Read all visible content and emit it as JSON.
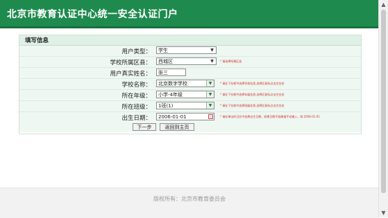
{
  "header": {
    "title": "北京市教育认证中心统一安全认证门户"
  },
  "panel": {
    "title": "填写信息"
  },
  "form": {
    "user_type": {
      "label": "用户类型：",
      "value": "学生"
    },
    "district": {
      "label": "学校所属区县：",
      "value": "西城区",
      "hint": "* 请选择所属区县"
    },
    "real_name": {
      "label": "用户真实姓名：",
      "value": "张三"
    },
    "school": {
      "label": "学校名称：",
      "value": "北京数字学校",
      "hint": "* 请在下拉框中选择学校信息,选择后鼠标点击空白处"
    },
    "grade": {
      "label": "所在年级：",
      "value": "小学-4年级",
      "hint": "* 请在下拉框中选择年级信息,选择后鼠标点击空白处"
    },
    "class": {
      "label": "所在班级：",
      "value": "1班(1)",
      "hint": "* 请在下拉框中选择班级信息,选择后鼠标点击空白处"
    },
    "birthday": {
      "label": "出生日期：",
      "value": "2006-01-01",
      "hint": "* 请在弹出的日历中选择出生日期，如果日期不准确请手动输入，如:2006-01-01"
    }
  },
  "buttons": {
    "next": "下一步",
    "home": "返回到主页"
  },
  "footer": {
    "copyright": "版权所有：北京市教育委员会"
  },
  "colors": {
    "header": "#1e8a4e",
    "row": "#eef7f1",
    "hint": "#d0302c"
  },
  "icons": {
    "scroll_up": "chevron-up-icon",
    "scroll_down": "chevron-down-icon",
    "calendar": "calendar-icon"
  }
}
